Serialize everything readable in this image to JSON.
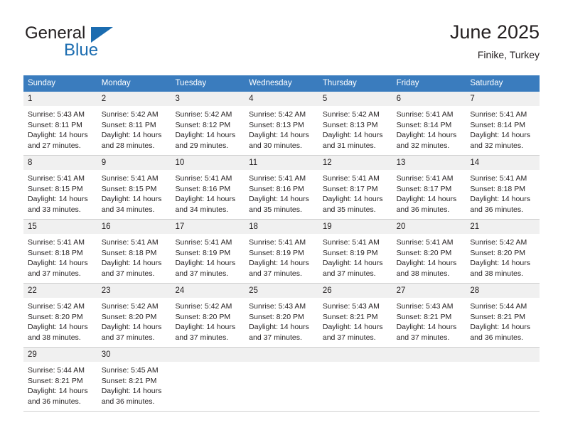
{
  "brand": {
    "name_primary": "General",
    "name_secondary": "Blue",
    "primary_color": "#231f20",
    "accent_color": "#1b6cb0"
  },
  "header": {
    "title": "June 2025",
    "location": "Finike, Turkey"
  },
  "calendar": {
    "header_bg": "#3a7cbe",
    "daynum_bg": "#f0f0f0",
    "weekdays": [
      "Sunday",
      "Monday",
      "Tuesday",
      "Wednesday",
      "Thursday",
      "Friday",
      "Saturday"
    ],
    "weeks": [
      [
        {
          "day": "1",
          "sunrise": "Sunrise: 5:43 AM",
          "sunset": "Sunset: 8:11 PM",
          "daylight1": "Daylight: 14 hours",
          "daylight2": "and 27 minutes."
        },
        {
          "day": "2",
          "sunrise": "Sunrise: 5:42 AM",
          "sunset": "Sunset: 8:11 PM",
          "daylight1": "Daylight: 14 hours",
          "daylight2": "and 28 minutes."
        },
        {
          "day": "3",
          "sunrise": "Sunrise: 5:42 AM",
          "sunset": "Sunset: 8:12 PM",
          "daylight1": "Daylight: 14 hours",
          "daylight2": "and 29 minutes."
        },
        {
          "day": "4",
          "sunrise": "Sunrise: 5:42 AM",
          "sunset": "Sunset: 8:13 PM",
          "daylight1": "Daylight: 14 hours",
          "daylight2": "and 30 minutes."
        },
        {
          "day": "5",
          "sunrise": "Sunrise: 5:42 AM",
          "sunset": "Sunset: 8:13 PM",
          "daylight1": "Daylight: 14 hours",
          "daylight2": "and 31 minutes."
        },
        {
          "day": "6",
          "sunrise": "Sunrise: 5:41 AM",
          "sunset": "Sunset: 8:14 PM",
          "daylight1": "Daylight: 14 hours",
          "daylight2": "and 32 minutes."
        },
        {
          "day": "7",
          "sunrise": "Sunrise: 5:41 AM",
          "sunset": "Sunset: 8:14 PM",
          "daylight1": "Daylight: 14 hours",
          "daylight2": "and 32 minutes."
        }
      ],
      [
        {
          "day": "8",
          "sunrise": "Sunrise: 5:41 AM",
          "sunset": "Sunset: 8:15 PM",
          "daylight1": "Daylight: 14 hours",
          "daylight2": "and 33 minutes."
        },
        {
          "day": "9",
          "sunrise": "Sunrise: 5:41 AM",
          "sunset": "Sunset: 8:15 PM",
          "daylight1": "Daylight: 14 hours",
          "daylight2": "and 34 minutes."
        },
        {
          "day": "10",
          "sunrise": "Sunrise: 5:41 AM",
          "sunset": "Sunset: 8:16 PM",
          "daylight1": "Daylight: 14 hours",
          "daylight2": "and 34 minutes."
        },
        {
          "day": "11",
          "sunrise": "Sunrise: 5:41 AM",
          "sunset": "Sunset: 8:16 PM",
          "daylight1": "Daylight: 14 hours",
          "daylight2": "and 35 minutes."
        },
        {
          "day": "12",
          "sunrise": "Sunrise: 5:41 AM",
          "sunset": "Sunset: 8:17 PM",
          "daylight1": "Daylight: 14 hours",
          "daylight2": "and 35 minutes."
        },
        {
          "day": "13",
          "sunrise": "Sunrise: 5:41 AM",
          "sunset": "Sunset: 8:17 PM",
          "daylight1": "Daylight: 14 hours",
          "daylight2": "and 36 minutes."
        },
        {
          "day": "14",
          "sunrise": "Sunrise: 5:41 AM",
          "sunset": "Sunset: 8:18 PM",
          "daylight1": "Daylight: 14 hours",
          "daylight2": "and 36 minutes."
        }
      ],
      [
        {
          "day": "15",
          "sunrise": "Sunrise: 5:41 AM",
          "sunset": "Sunset: 8:18 PM",
          "daylight1": "Daylight: 14 hours",
          "daylight2": "and 37 minutes."
        },
        {
          "day": "16",
          "sunrise": "Sunrise: 5:41 AM",
          "sunset": "Sunset: 8:18 PM",
          "daylight1": "Daylight: 14 hours",
          "daylight2": "and 37 minutes."
        },
        {
          "day": "17",
          "sunrise": "Sunrise: 5:41 AM",
          "sunset": "Sunset: 8:19 PM",
          "daylight1": "Daylight: 14 hours",
          "daylight2": "and 37 minutes."
        },
        {
          "day": "18",
          "sunrise": "Sunrise: 5:41 AM",
          "sunset": "Sunset: 8:19 PM",
          "daylight1": "Daylight: 14 hours",
          "daylight2": "and 37 minutes."
        },
        {
          "day": "19",
          "sunrise": "Sunrise: 5:41 AM",
          "sunset": "Sunset: 8:19 PM",
          "daylight1": "Daylight: 14 hours",
          "daylight2": "and 37 minutes."
        },
        {
          "day": "20",
          "sunrise": "Sunrise: 5:41 AM",
          "sunset": "Sunset: 8:20 PM",
          "daylight1": "Daylight: 14 hours",
          "daylight2": "and 38 minutes."
        },
        {
          "day": "21",
          "sunrise": "Sunrise: 5:42 AM",
          "sunset": "Sunset: 8:20 PM",
          "daylight1": "Daylight: 14 hours",
          "daylight2": "and 38 minutes."
        }
      ],
      [
        {
          "day": "22",
          "sunrise": "Sunrise: 5:42 AM",
          "sunset": "Sunset: 8:20 PM",
          "daylight1": "Daylight: 14 hours",
          "daylight2": "and 38 minutes."
        },
        {
          "day": "23",
          "sunrise": "Sunrise: 5:42 AM",
          "sunset": "Sunset: 8:20 PM",
          "daylight1": "Daylight: 14 hours",
          "daylight2": "and 37 minutes."
        },
        {
          "day": "24",
          "sunrise": "Sunrise: 5:42 AM",
          "sunset": "Sunset: 8:20 PM",
          "daylight1": "Daylight: 14 hours",
          "daylight2": "and 37 minutes."
        },
        {
          "day": "25",
          "sunrise": "Sunrise: 5:43 AM",
          "sunset": "Sunset: 8:20 PM",
          "daylight1": "Daylight: 14 hours",
          "daylight2": "and 37 minutes."
        },
        {
          "day": "26",
          "sunrise": "Sunrise: 5:43 AM",
          "sunset": "Sunset: 8:21 PM",
          "daylight1": "Daylight: 14 hours",
          "daylight2": "and 37 minutes."
        },
        {
          "day": "27",
          "sunrise": "Sunrise: 5:43 AM",
          "sunset": "Sunset: 8:21 PM",
          "daylight1": "Daylight: 14 hours",
          "daylight2": "and 37 minutes."
        },
        {
          "day": "28",
          "sunrise": "Sunrise: 5:44 AM",
          "sunset": "Sunset: 8:21 PM",
          "daylight1": "Daylight: 14 hours",
          "daylight2": "and 36 minutes."
        }
      ],
      [
        {
          "day": "29",
          "sunrise": "Sunrise: 5:44 AM",
          "sunset": "Sunset: 8:21 PM",
          "daylight1": "Daylight: 14 hours",
          "daylight2": "and 36 minutes."
        },
        {
          "day": "30",
          "sunrise": "Sunrise: 5:45 AM",
          "sunset": "Sunset: 8:21 PM",
          "daylight1": "Daylight: 14 hours",
          "daylight2": "and 36 minutes."
        },
        {
          "day": "",
          "sunrise": "",
          "sunset": "",
          "daylight1": "",
          "daylight2": ""
        },
        {
          "day": "",
          "sunrise": "",
          "sunset": "",
          "daylight1": "",
          "daylight2": ""
        },
        {
          "day": "",
          "sunrise": "",
          "sunset": "",
          "daylight1": "",
          "daylight2": ""
        },
        {
          "day": "",
          "sunrise": "",
          "sunset": "",
          "daylight1": "",
          "daylight2": ""
        },
        {
          "day": "",
          "sunrise": "",
          "sunset": "",
          "daylight1": "",
          "daylight2": ""
        }
      ]
    ]
  }
}
